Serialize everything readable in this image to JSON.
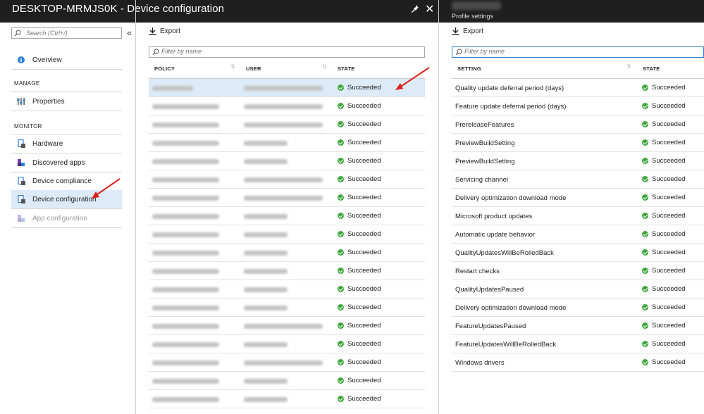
{
  "main_blade": {
    "title": "DESKTOP-MRMJS0K - Device configuration",
    "pin_icon": "pin-icon",
    "close_icon": "close-icon"
  },
  "side_nav": {
    "search_placeholder": "Search (Ctrl+/)",
    "collapse_icon": "double-chevron-left-icon",
    "overview_label": "Overview",
    "manage_section": "MANAGE",
    "properties_label": "Properties",
    "monitor_section": "MONITOR",
    "items": [
      {
        "label": "Hardware",
        "icon": "hardware-icon",
        "active": false,
        "disabled": false
      },
      {
        "label": "Discovered apps",
        "icon": "apps-icon",
        "active": false,
        "disabled": false
      },
      {
        "label": "Device compliance",
        "icon": "compliance-icon",
        "active": false,
        "disabled": false
      },
      {
        "label": "Device configuration",
        "icon": "configuration-icon",
        "active": true,
        "disabled": false
      },
      {
        "label": "App configuration",
        "icon": "app-configuration-icon",
        "active": false,
        "disabled": true
      }
    ]
  },
  "policy_list": {
    "export_label": "Export",
    "filter_placeholder": "Filter by name",
    "columns": [
      "POLICY",
      "USER",
      "STATE"
    ],
    "row_state": "Succeeded",
    "row_count": 18,
    "selected_row": 0
  },
  "profile_settings": {
    "subtitle": "Profile settings",
    "export_label": "Export",
    "filter_placeholder": "Filter by name",
    "columns": [
      "SETTING",
      "STATE"
    ],
    "rows": [
      {
        "setting": "Quality update deferral period (days)",
        "state": "Succeeded"
      },
      {
        "setting": "Feature update deferral period (days)",
        "state": "Succeeded"
      },
      {
        "setting": "PrereleaseFeatures",
        "state": "Succeeded"
      },
      {
        "setting": "PreviewBuildSetting",
        "state": "Succeeded"
      },
      {
        "setting": "PreviewBuildSetting",
        "state": "Succeeded"
      },
      {
        "setting": "Servicing channel",
        "state": "Succeeded"
      },
      {
        "setting": "Delivery optimization download mode",
        "state": "Succeeded"
      },
      {
        "setting": "Microsoft product updates",
        "state": "Succeeded"
      },
      {
        "setting": "Automatic update behavior",
        "state": "Succeeded"
      },
      {
        "setting": "QualityUpdatesWillBeRolledBack",
        "state": "Succeeded"
      },
      {
        "setting": "Restart checks",
        "state": "Succeeded"
      },
      {
        "setting": "QualityUpdatesPaused",
        "state": "Succeeded"
      },
      {
        "setting": "Delivery optimization download mode",
        "state": "Succeeded"
      },
      {
        "setting": "FeatureUpdatesPaused",
        "state": "Succeeded"
      },
      {
        "setting": "FeatureUpdatesWillBeRolledBack",
        "state": "Succeeded"
      },
      {
        "setting": "Windows drivers",
        "state": "Succeeded"
      }
    ]
  },
  "colors": {
    "title_bar": "#1f1f1f",
    "selection": "#ddeaf7",
    "success": "#3ea63e",
    "annotation_arrow": "#d9221c"
  }
}
